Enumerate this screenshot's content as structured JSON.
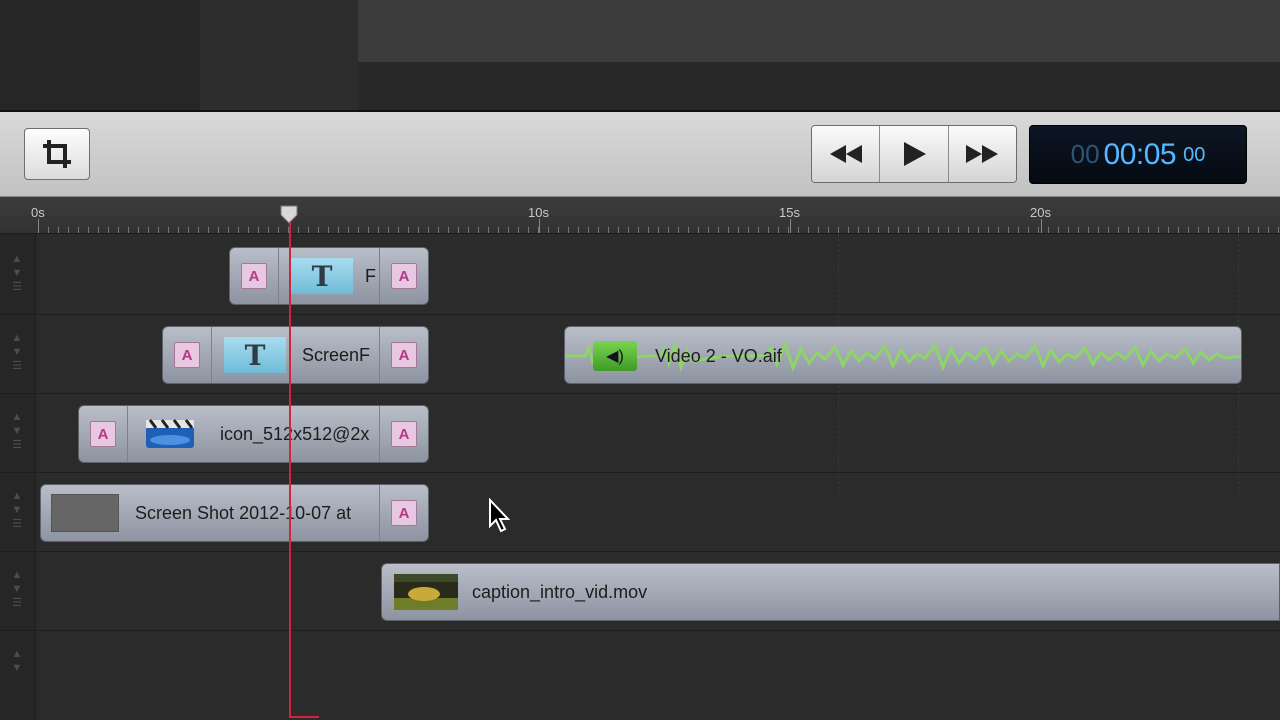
{
  "timecode": {
    "hours": "00",
    "main": "00:05",
    "frames": "00"
  },
  "ruler": {
    "labels": [
      "0s",
      "10s",
      "15s",
      "20s"
    ]
  },
  "clips": {
    "title_a": {
      "label": "F"
    },
    "title_b": {
      "label": "ScreenF"
    },
    "icon_clip": {
      "label": "icon_512x512@2x"
    },
    "screenshot_clip": {
      "label": "Screen Shot 2012-10-07 at"
    },
    "audio_clip": {
      "label": "Video 2 - VO.aif"
    },
    "video_clip": {
      "label": "caption_intro_vid.mov"
    }
  },
  "badge_letter": "A",
  "title_glyph": "T",
  "colors": {
    "playhead": "#d1243f",
    "timecode_text": "#54b9ff",
    "waveform": "#8fd46a",
    "badge": "#e8c7e2"
  }
}
